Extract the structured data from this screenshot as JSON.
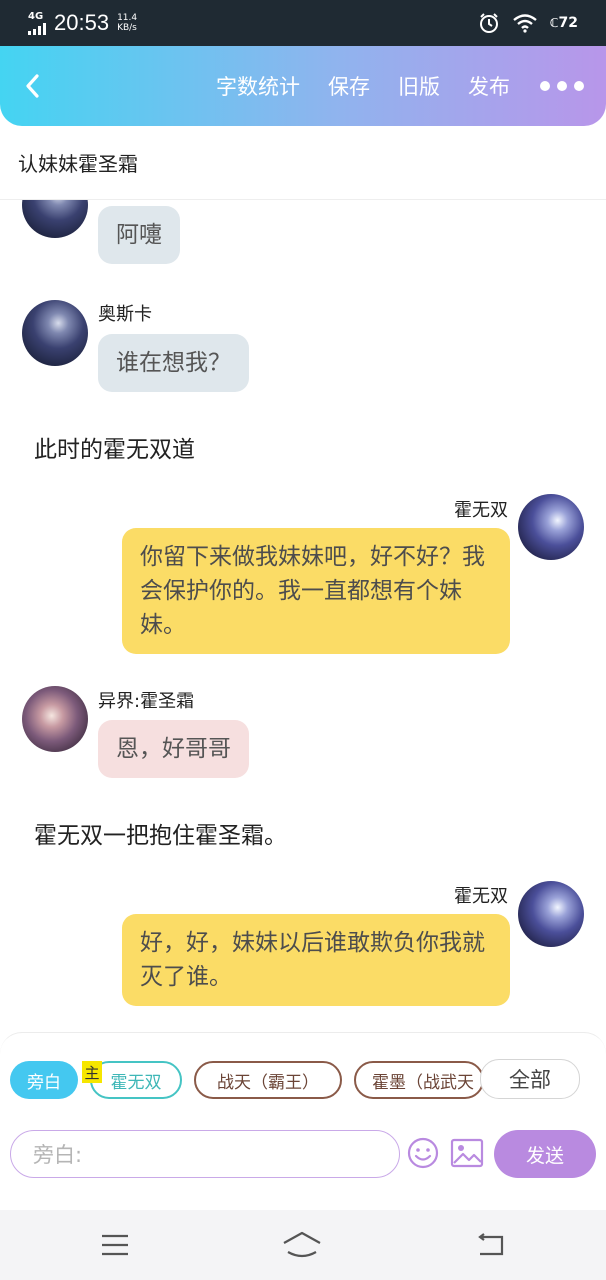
{
  "status_bar": {
    "network": "4G",
    "clock": "20:53",
    "speed_value": "11.4",
    "speed_unit": "KB/s",
    "battery": "72"
  },
  "header": {
    "back_icon": "chevron-left-icon",
    "actions": [
      "字数统计",
      "保存",
      "旧版",
      "发布"
    ],
    "more_icon": "more-dots-icon",
    "gradient": [
      "#44d4f2",
      "#b896ea"
    ]
  },
  "title": "认妹妹霍圣霜",
  "messages": [
    {
      "type": "left",
      "speaker": "",
      "text": "阿嚏"
    },
    {
      "type": "left",
      "speaker": "奥斯卡",
      "text": "谁在想我？"
    },
    {
      "type": "narration",
      "text": "此时的霍无双道"
    },
    {
      "type": "right",
      "speaker": "霍无双",
      "text": "你留下来做我妹妹吧，好不好？我会保护你的。我一直都想有个妹妹。"
    },
    {
      "type": "left",
      "speaker": "异界:霍圣霜",
      "text": "恩，好哥哥"
    },
    {
      "type": "narration",
      "text": "霍无双一把抱住霍圣霜。"
    },
    {
      "type": "right",
      "speaker": "霍无双",
      "text": "好，好，妹妹以后谁敢欺负你我就灭了谁。"
    }
  ],
  "roles": {
    "narrator": "旁白",
    "main_badge": "主",
    "items": [
      "霍无双",
      "战天（霸王）",
      "霍墨（战武天"
    ],
    "all": "全部"
  },
  "input": {
    "placeholder": "旁白:",
    "emoji_icon": "smiley-icon",
    "image_icon": "image-icon",
    "send": "发送"
  },
  "colors": {
    "accent_purple": "#b98ae0",
    "bubble_yellow": "#fbdc66",
    "bubble_grey": "#dfe7ec",
    "bubble_pink": "#f6dfdf",
    "narrator_blue": "#44c8f0"
  },
  "navbar": [
    "menu-icon",
    "home-icon",
    "back-icon"
  ]
}
